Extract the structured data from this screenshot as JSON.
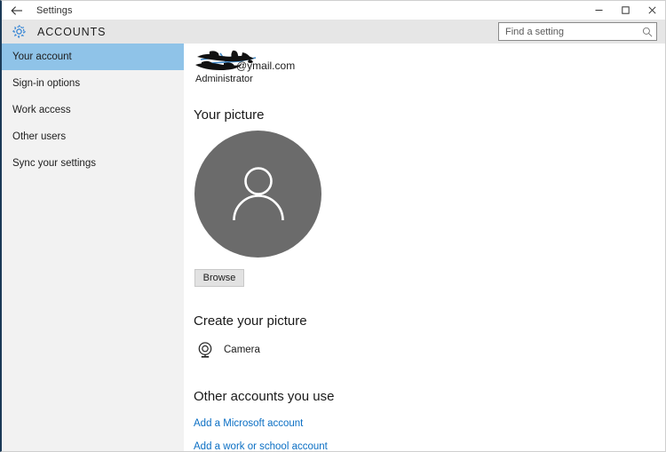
{
  "window": {
    "title": "Settings",
    "back_icon": "back-arrow-icon",
    "minimize_label": "─",
    "maximize_label": "□",
    "close_label": "✕"
  },
  "header": {
    "icon": "gear-icon",
    "title": "ACCOUNTS"
  },
  "search": {
    "placeholder": "Find a setting",
    "value": "",
    "icon": "search-icon"
  },
  "sidebar": {
    "items": [
      {
        "label": "Your account",
        "selected": true
      },
      {
        "label": "Sign-in options",
        "selected": false
      },
      {
        "label": "Work access",
        "selected": false
      },
      {
        "label": "Other users",
        "selected": false
      },
      {
        "label": "Sync your settings",
        "selected": false
      }
    ]
  },
  "account": {
    "email": "@ymail.com",
    "email_redacted": true,
    "role": "Administrator"
  },
  "main": {
    "your_picture_heading": "Your picture",
    "avatar_icon": "person-silhouette-icon",
    "browse_label": "Browse",
    "create_picture_heading": "Create your picture",
    "camera_icon": "webcam-icon",
    "camera_label": "Camera",
    "other_accounts_heading": "Other accounts you use",
    "link_microsoft": "Add a Microsoft account",
    "link_work_school": "Add a work or school account"
  },
  "colors": {
    "accent_blue": "#2a7fd4",
    "selection_blue": "#8fc3e8",
    "link_blue": "#0b6fc4",
    "sidebar_bg": "#f2f2f2",
    "header_bg": "#e6e6e6",
    "avatar_gray": "#6b6b6b",
    "window_border": "#1b3a57"
  }
}
